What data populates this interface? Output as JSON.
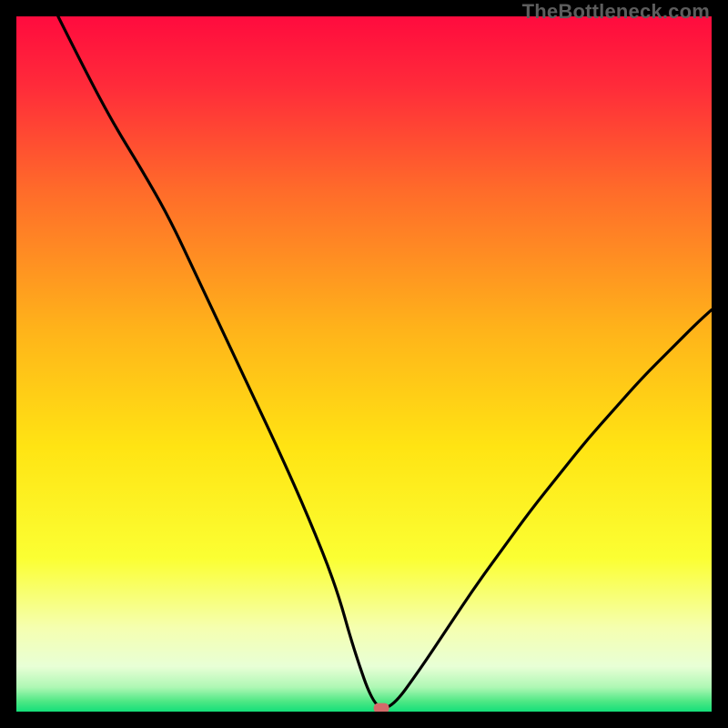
{
  "watermark": "TheBottleneck.com",
  "chart_data": {
    "type": "line",
    "title": "",
    "xlabel": "",
    "ylabel": "",
    "xlim": [
      0,
      100
    ],
    "ylim": [
      0,
      100
    ],
    "series": [
      {
        "name": "bottleneck-curve",
        "x": [
          6,
          10,
          14,
          18,
          22,
          26,
          30,
          34,
          38,
          42,
          46,
          48.5,
          51.5,
          54,
          58,
          62,
          66,
          70,
          74,
          78,
          82,
          86,
          90,
          94,
          98,
          100
        ],
        "y": [
          100,
          92,
          84.5,
          78,
          71,
          62.5,
          54,
          45.5,
          37,
          28,
          18,
          9,
          0.5,
          0.5,
          6,
          12,
          18,
          23.5,
          29,
          34,
          39,
          43.5,
          48,
          52,
          56,
          57.8
        ]
      }
    ],
    "marker": {
      "x": 52.5,
      "y": 0.5,
      "color": "#d46a6a"
    },
    "gradient_stops": [
      {
        "offset": 0.0,
        "color": "#ff0b3e"
      },
      {
        "offset": 0.1,
        "color": "#ff2b3a"
      },
      {
        "offset": 0.25,
        "color": "#ff6b2a"
      },
      {
        "offset": 0.45,
        "color": "#ffb31a"
      },
      {
        "offset": 0.62,
        "color": "#ffe413"
      },
      {
        "offset": 0.78,
        "color": "#fbff33"
      },
      {
        "offset": 0.88,
        "color": "#f5ffb0"
      },
      {
        "offset": 0.935,
        "color": "#e8ffd6"
      },
      {
        "offset": 0.965,
        "color": "#aef7b4"
      },
      {
        "offset": 0.985,
        "color": "#4fe885"
      },
      {
        "offset": 1.0,
        "color": "#14df7a"
      }
    ]
  }
}
